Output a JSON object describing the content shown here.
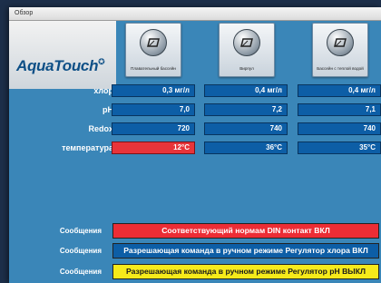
{
  "window": {
    "title": "Обзор"
  },
  "logo": {
    "text": "AquaTouch",
    "mark": "✪"
  },
  "pools": [
    {
      "name": "Плавательный бассейн",
      "icon": "pool-gauge-icon"
    },
    {
      "name": "Вирпул",
      "icon": "whirlpool-gauge-icon"
    },
    {
      "name": "Бассейн с теплой водой",
      "icon": "warm-pool-gauge-icon"
    }
  ],
  "rows": [
    {
      "label": "хлор",
      "values": [
        "0,3 мг/л",
        "0,4 мг/л",
        "0,4 мг/л"
      ],
      "alarm": [
        false,
        false,
        false
      ]
    },
    {
      "label": "pH",
      "values": [
        "7,0",
        "7,2",
        "7,1"
      ],
      "alarm": [
        false,
        false,
        false
      ]
    },
    {
      "label": "Redox",
      "values": [
        "720",
        "740",
        "740"
      ],
      "alarm": [
        false,
        false,
        false
      ]
    },
    {
      "label": "температура",
      "values": [
        "12°C",
        "36°C",
        "35°C"
      ],
      "alarm": [
        true,
        false,
        false
      ]
    }
  ],
  "messages": [
    {
      "label": "Сообщения",
      "text": "Соответствующий нормам DIN контакт ВКЛ",
      "style": "red"
    },
    {
      "label": "Сообщения",
      "text": "Разрешающая команда в ручном режиме Регулятор хлора ВКЛ",
      "style": "blue"
    },
    {
      "label": "Сообщения",
      "text": "Разрешающая команда в ручном режиме Регулятор pH ВЫКЛ",
      "style": "yellow"
    }
  ],
  "colors": {
    "background": "#3a86b8",
    "cell": "#0d5ea6",
    "alarm": "#e8343a",
    "message_red": "#ec2d35",
    "message_yellow": "#f6ea1a"
  }
}
